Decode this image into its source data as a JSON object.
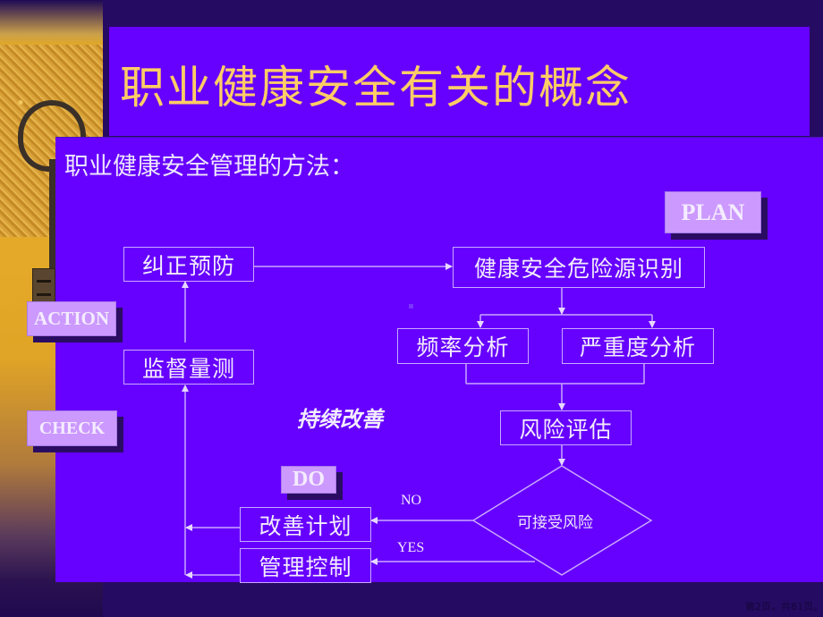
{
  "slide": {
    "title": "职业健康安全有关的概念",
    "subtitle": "职业健康安全管理的方法：",
    "colors": {
      "background": "#250B62",
      "panel": "#6600FF",
      "title_text": "#FFCC66",
      "tag_fill": "#CC99FF",
      "line": "#C9A8FF"
    }
  },
  "pdca_tags": {
    "plan": "PLAN",
    "do": "DO",
    "check": "CHECK",
    "action": "ACTION"
  },
  "flow": {
    "corrective_prevention": "纠正预防",
    "hazard_identification": "健康安全危险源识别",
    "frequency_analysis": "频率分析",
    "severity_analysis": "严重度分析",
    "monitoring_measurement": "监督量测",
    "risk_assessment": "风险评估",
    "acceptable_risk": "可接受风险",
    "improvement_plan": "改善计划",
    "management_control": "管理控制",
    "no_label": "NO",
    "yes_label": "YES",
    "continuous_improvement": "持续改善"
  },
  "footer": {
    "page_indicator": "第2页，共81页。"
  }
}
